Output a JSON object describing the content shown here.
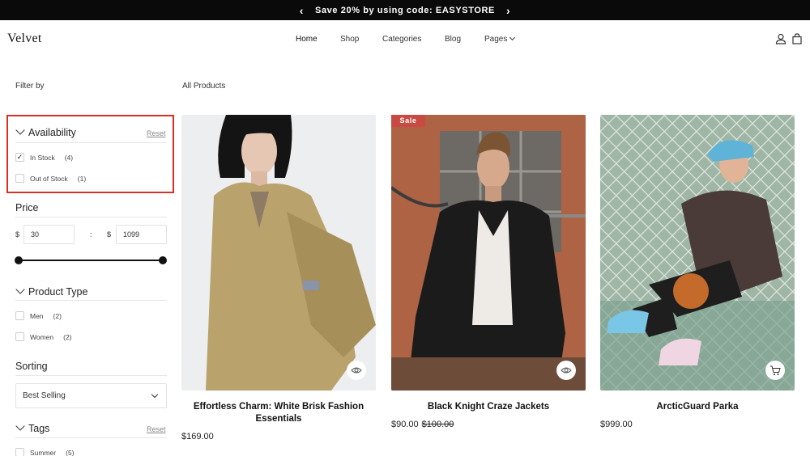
{
  "announcement": {
    "text": "Save 20% by using code: EASYSTORE",
    "prev": "‹",
    "next": "›"
  },
  "header": {
    "logo": "Velvet",
    "nav": [
      {
        "label": "Home"
      },
      {
        "label": "Shop"
      },
      {
        "label": "Categories"
      },
      {
        "label": "Blog"
      },
      {
        "label": "Pages"
      }
    ],
    "icons": [
      "user-icon",
      "shopping-bag-icon"
    ]
  },
  "sidebar": {
    "heading": "Filter by",
    "availability": {
      "title": "Availability",
      "reset": "Reset",
      "options": [
        {
          "label": "In Stock",
          "count": "(4)",
          "checked": true
        },
        {
          "label": "Out of Stock",
          "count": "(1)",
          "checked": false
        }
      ]
    },
    "price": {
      "title": "Price",
      "currency": "$",
      "min": "30",
      "max": "1099",
      "separator": ":"
    },
    "product_type": {
      "title": "Product Type",
      "options": [
        {
          "label": "Men",
          "count": "(2)"
        },
        {
          "label": "Women",
          "count": "(2)"
        }
      ]
    },
    "sorting": {
      "title": "Sorting",
      "selected": "Best Selling"
    },
    "tags": {
      "title": "Tags",
      "reset": "Reset",
      "options": [
        {
          "label": "Summer",
          "count": "(5)"
        }
      ]
    }
  },
  "main": {
    "heading": "All Products",
    "products": [
      {
        "name": "Effortless Charm: White Brisk Fashion Essentials",
        "price": "$169.00",
        "action_icon": "eye-icon"
      },
      {
        "name": "Black Knight Craze Jackets",
        "price": "$90.00",
        "compare_price": "$100.00",
        "badge": "Sale",
        "action_icon": "eye-icon"
      },
      {
        "name": "ArcticGuard Parka",
        "price": "$999.00",
        "action_icon": "cart-icon"
      }
    ]
  },
  "colors": {
    "accent_sale": "#c94a43",
    "highlight": "#d93025",
    "bar": "#0a0a0a"
  }
}
